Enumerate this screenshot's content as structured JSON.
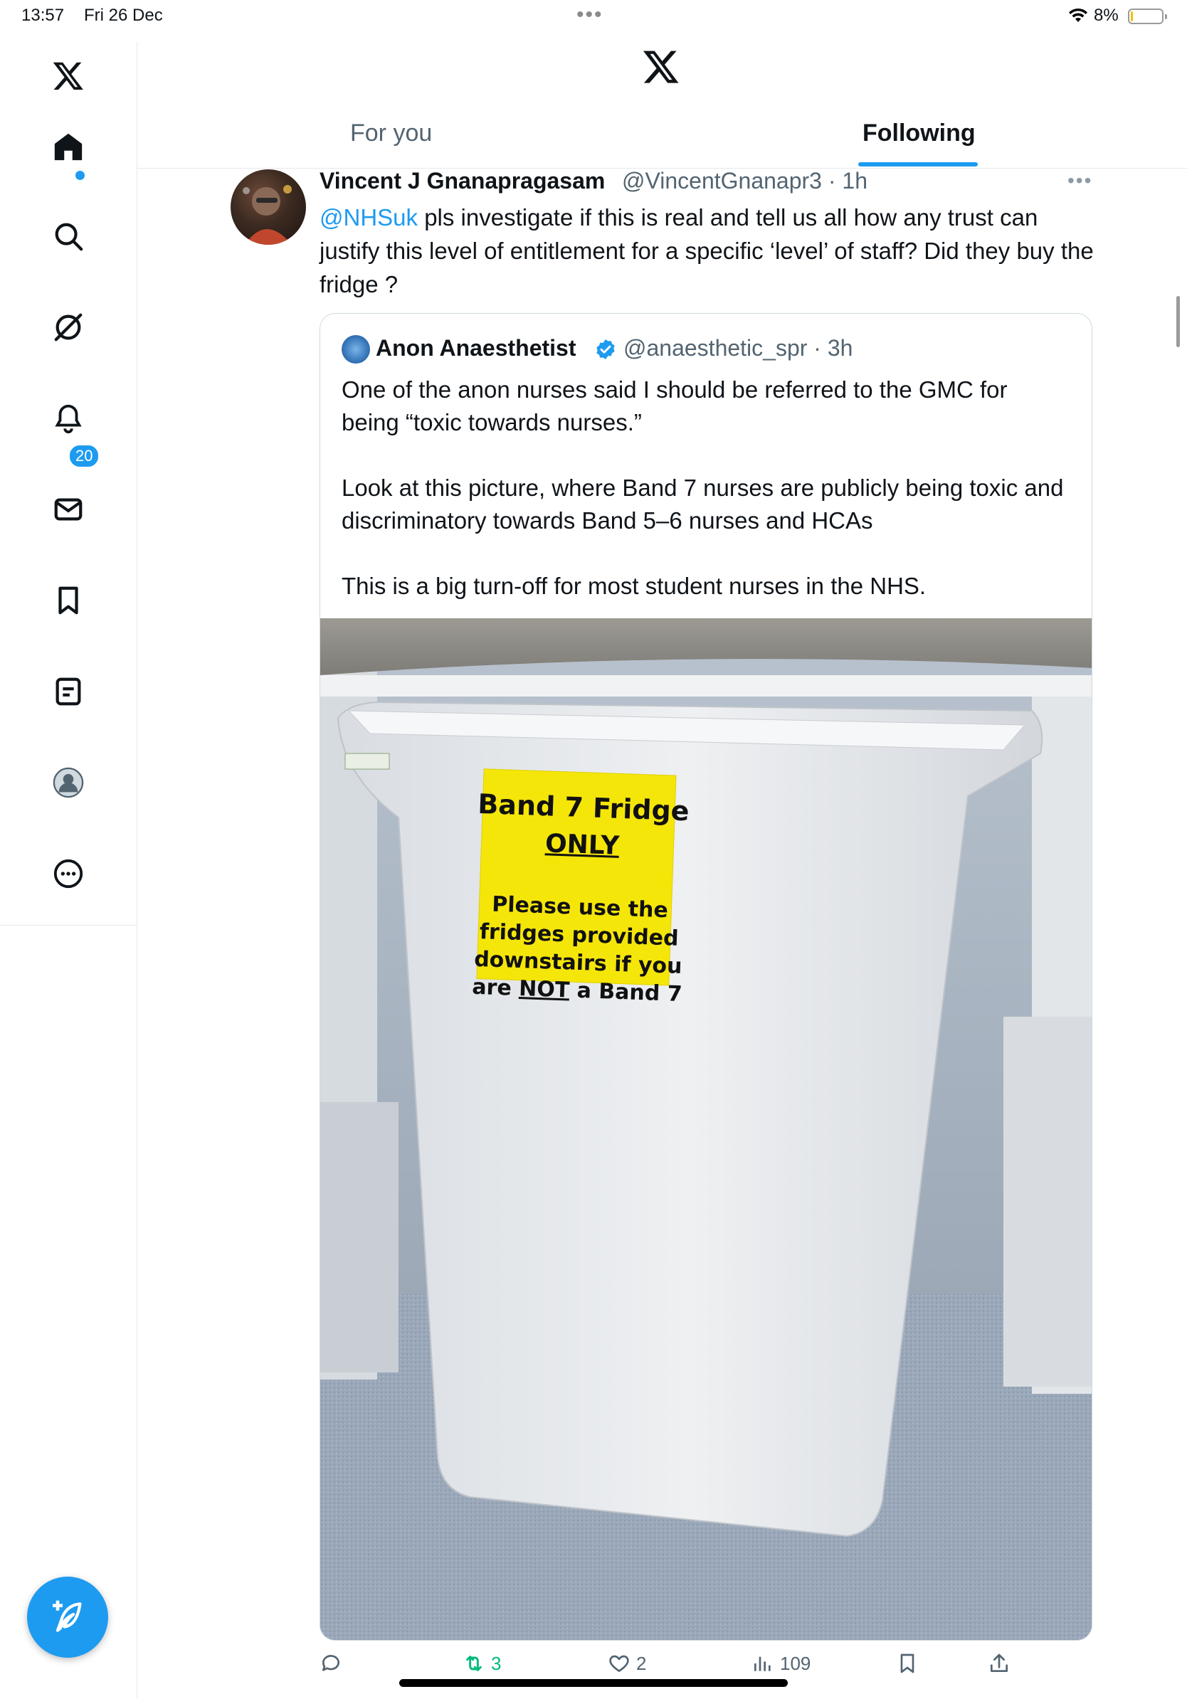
{
  "status_bar": {
    "time": "13:57",
    "date": "Fri 26 Dec",
    "battery": "8%",
    "battery_level": 0.08
  },
  "sidebar": {
    "items": [
      {
        "name": "x-logo-icon"
      },
      {
        "name": "home-icon"
      },
      {
        "name": "search-icon"
      },
      {
        "name": "grok-icon"
      },
      {
        "name": "notifications-icon",
        "badge": "20"
      },
      {
        "name": "messages-icon"
      },
      {
        "name": "bookmarks-icon"
      },
      {
        "name": "lists-icon"
      },
      {
        "name": "profile-icon"
      },
      {
        "name": "more-icon"
      }
    ]
  },
  "header": {
    "tabs": [
      {
        "label": "For you"
      },
      {
        "label": "Following"
      }
    ],
    "active_tab": "Following"
  },
  "tweet": {
    "name": "Vincent J Gnanapragasam",
    "handle": "@VincentGnanapr3",
    "time": "1h",
    "mention": "@NHSuk",
    "text": " pls investigate if this is real and tell us all how any trust can justify this level of entitlement for a specific ‘level’ of staff? Did they buy the fridge ?",
    "quote": {
      "name": "Anon Anaesthetist",
      "handle": "@anaesthetic_spr",
      "time": "3h",
      "text": "One of the anon nurses said I should be referred to the GMC for being “toxic towards nurses.”\n\nLook at this picture, where Band 7 nurses are publicly being toxic and discriminatory towards Band 5–6 nurses and HCAs\n\nThis is a big turn-off for most student nurses in the NHS.",
      "image_sign": {
        "line1": "Band 7 Fridge",
        "line2": "ONLY",
        "line3": "Please use the",
        "line4": "fridges provided",
        "line5": "downstairs if you",
        "line6_a": "are ",
        "line6_b": "NOT",
        "line6_c": " a Band 7"
      }
    },
    "actions": {
      "replies": "",
      "reposts": "3",
      "likes": "2",
      "views": "109"
    }
  },
  "colors": {
    "accent": "#1d9bf0",
    "repost": "#00ba7c",
    "sign_yellow": "#f5e60a"
  }
}
